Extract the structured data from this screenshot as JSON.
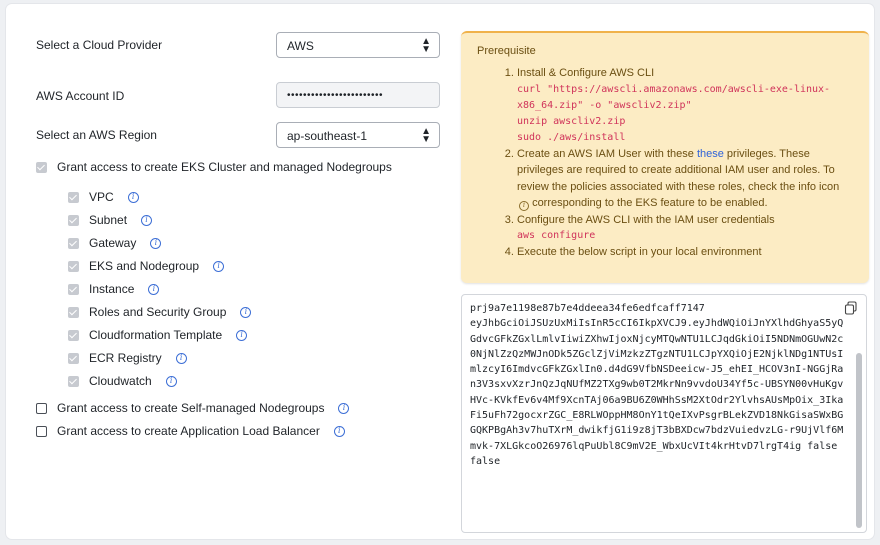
{
  "form": {
    "provider_label": "Select a Cloud Provider",
    "provider_value": "AWS",
    "account_label": "AWS Account ID",
    "account_value": "••••••••••••••••••••••••",
    "region_label": "Select an AWS Region",
    "region_value": "ap-southeast-1",
    "eks_label": "Grant access to create EKS Cluster and managed Nodegroups",
    "eks_items": [
      "VPC",
      "Subnet",
      "Gateway",
      "EKS and Nodegroup",
      "Instance",
      "Roles and Security Group",
      "Cloudformation Template",
      "ECR Registry",
      "Cloudwatch"
    ],
    "self_managed_label": "Grant access to create Self-managed Nodegroups",
    "alb_label": "Grant access to create Application Load Balancer"
  },
  "prereq": {
    "title": "Prerequisite",
    "step1": "Install & Configure AWS CLI",
    "step1_code": [
      "curl \"https://awscli.amazonaws.com/awscli-exe-linux-",
      "x86_64.zip\" -o \"awscliv2.zip\"",
      "unzip awscliv2.zip",
      "sudo ./aws/install"
    ],
    "step2_a": "Create an AWS IAM User with these ",
    "step2_link": "these",
    "step2_b": " privileges. These privileges are required to create additional IAM user and roles. To review the policies associated with these roles, check the info icon",
    "step2_c": " corresponding to the EKS feature to be enabled.",
    "step3": "Configure the AWS CLI with the IAM user credentials",
    "step3_code": "aws configure",
    "step4": "Execute the below script in your local environment"
  },
  "script": {
    "text": "prj9a7e1198e87b7e4ddeea34fe6edfcaff7147\neyJhbGciOiJSUzUxMiIsInR5cCI6IkpXVCJ9.eyJhdWQiOiJnYXlhdGhyaS5yQGdvcGFkZGxlLmlvIiwiZXhwIjoxNjcyMTQwNTU1LCJqdGkiOiI5NDNmOGUwN2c0NjNlZzQzMWJnODk5ZGclZjViMzkzZTgzNTU1LCJpYXQiOjE2NjklNDg1NTUsImlzcyI6ImdvcGFkZGxlIn0.d4dG9VfbNSDeeicw-J5_ehEI_HCOV3nI-NGGjRan3V3sxvXzrJnQzJqNUfMZ2TXg9wb0T2MkrNn9vvdoU34Yf5c-UBSYN00vHuKgvHVc-KVkfEv6v4Mf9XcnTAj06a9BU6Z0WHhSsM2XtOdr2YlvhsAUsMpOix_3IkaFi5uFh72gocxrZGC_E8RLWOppHM8OnY1tQeIXvPsgrBLekZVD18NkGisaSWxBGGQKPBgAh3v7huTXrM_dwikfjG1i9z8jT3bBXDcw7bdzVuiedvzLG-r9UjVlf6Mmvk-7XLGkcoO26976lqPuUbl8C9mV2E_WbxUcVIt4krHtvD7lrgT4ig false false"
  }
}
